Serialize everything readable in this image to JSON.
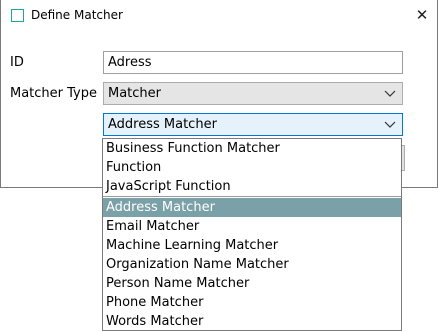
{
  "window": {
    "title": "Define Matcher",
    "close_label": "✕"
  },
  "form": {
    "id_label": "ID",
    "id_value": "Adress",
    "type_label": "Matcher Type",
    "type_value": "Matcher",
    "subtype_value": "Address Matcher"
  },
  "dropdown": {
    "group1": [
      "Business Function Matcher",
      "Function",
      "JavaScript Function"
    ],
    "group2": [
      "Address Matcher",
      "Email Matcher",
      "Machine Learning Matcher",
      "Organization Name Matcher",
      "Person Name Matcher",
      "Phone Matcher",
      "Words Matcher"
    ],
    "selected": "Address Matcher"
  },
  "colors": {
    "accent": "#0078d7",
    "selected_bg": "#7aa0a8",
    "icon": "#1aa3a3"
  }
}
